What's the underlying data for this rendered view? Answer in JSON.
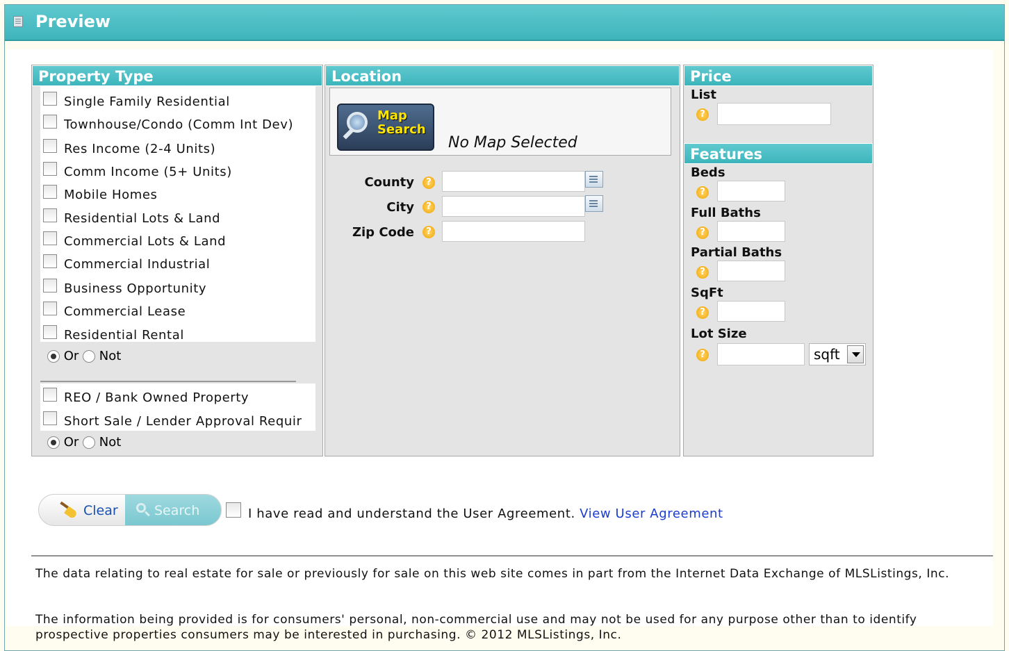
{
  "window": {
    "title": "Preview",
    "icon": "document-icon"
  },
  "property_type": {
    "heading": "Property Type",
    "items": [
      "Single Family Residential",
      "Townhouse/Condo (Comm Int Dev)",
      "Res Income (2-4 Units)",
      "Comm Income (5+ Units)",
      "Mobile Homes",
      "Residential Lots & Land",
      "Commercial Lots & Land",
      "Commercial Industrial",
      "Business Opportunity",
      "Commercial Lease",
      "Residential Rental"
    ],
    "radio1": {
      "or": "Or",
      "not": "Not",
      "selected": "Or"
    },
    "items2": [
      "REO / Bank Owned Property",
      "Short Sale / Lender Approval Requir"
    ],
    "radio2": {
      "or": "Or",
      "not": "Not",
      "selected": "Or"
    }
  },
  "location": {
    "heading": "Location",
    "map_button": {
      "line1": "Map",
      "line2": "Search"
    },
    "map_status": "No Map Selected",
    "fields": {
      "county": "County",
      "city": "City",
      "zip": "Zip Code"
    }
  },
  "price": {
    "heading": "Price",
    "list_label": "List"
  },
  "features": {
    "heading": "Features",
    "beds": "Beds",
    "full_baths": "Full Baths",
    "partial_baths": "Partial Baths",
    "sqft": "SqFt",
    "lot_size": "Lot Size",
    "lot_unit": "sqft"
  },
  "actions": {
    "clear": "Clear",
    "search": "Search"
  },
  "agreement": {
    "text": "I have read and understand the User Agreement.",
    "link": "View User Agreement"
  },
  "disclaimer": {
    "p1": "The data relating to real estate for sale or previously for sale on this web site comes in part from the Internet Data Exchange of MLSListings, Inc.",
    "p2": "The information being provided is for consumers' personal, non-commercial use and may not be used for any purpose other than to identify prospective properties consumers may be interested in purchasing. © 2012 MLSListings, Inc."
  },
  "colors": {
    "header": "#3fb4bb",
    "panel_bg": "#e4e4e4",
    "link": "#1a3cd0",
    "help": "#f0a400"
  }
}
